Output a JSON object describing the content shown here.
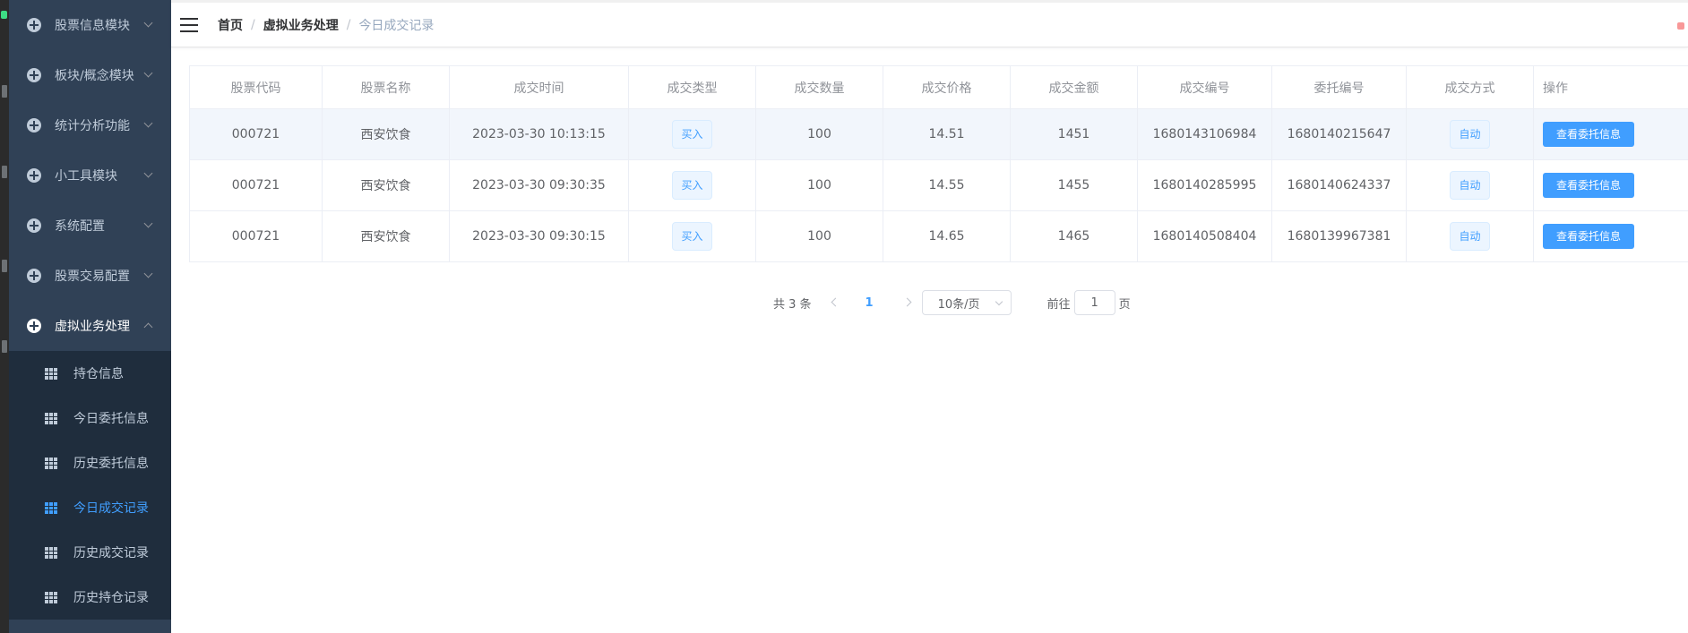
{
  "sidebar": {
    "menus": [
      {
        "label": "股票信息模块"
      },
      {
        "label": "板块/概念模块"
      },
      {
        "label": "统计分析功能"
      },
      {
        "label": "小工具模块"
      },
      {
        "label": "系统配置"
      },
      {
        "label": "股票交易配置"
      },
      {
        "label": "虚拟业务处理"
      }
    ],
    "submenu": [
      {
        "label": "持仓信息"
      },
      {
        "label": "今日委托信息"
      },
      {
        "label": "历史委托信息"
      },
      {
        "label": "今日成交记录"
      },
      {
        "label": "历史成交记录"
      },
      {
        "label": "历史持仓记录"
      }
    ],
    "active_submenu": "今日成交记录"
  },
  "breadcrumb": {
    "home": "首页",
    "section": "虚拟业务处理",
    "current": "今日成交记录",
    "separator": "/"
  },
  "table": {
    "columns": [
      "股票代码",
      "股票名称",
      "成交时间",
      "成交类型",
      "成交数量",
      "成交价格",
      "成交金额",
      "成交编号",
      "委托编号",
      "成交方式",
      "操作"
    ],
    "rows": [
      {
        "code": "000721",
        "name": "西安饮食",
        "time": "2023-03-30 10:13:15",
        "type": "买入",
        "qty": "100",
        "price": "14.51",
        "amount": "1451",
        "deal_no": "1680143106984",
        "order_no": "1680140215647",
        "mode": "自动",
        "action": "查看委托信息"
      },
      {
        "code": "000721",
        "name": "西安饮食",
        "time": "2023-03-30 09:30:35",
        "type": "买入",
        "qty": "100",
        "price": "14.55",
        "amount": "1455",
        "deal_no": "1680140285995",
        "order_no": "1680140624337",
        "mode": "自动",
        "action": "查看委托信息"
      },
      {
        "code": "000721",
        "name": "西安饮食",
        "time": "2023-03-30 09:30:15",
        "type": "买入",
        "qty": "100",
        "price": "14.65",
        "amount": "1465",
        "deal_no": "1680140508404",
        "order_no": "1680139967381",
        "mode": "自动",
        "action": "查看委托信息"
      }
    ]
  },
  "pagination": {
    "total": "共 3 条",
    "current_page": "1",
    "page_size": "10条/页",
    "goto_prefix": "前往",
    "goto_value": "1",
    "goto_suffix": "页"
  },
  "colors": {
    "sidebar_bg": "#304156",
    "submenu_bg": "#1f2d3d",
    "accent": "#409eff"
  }
}
